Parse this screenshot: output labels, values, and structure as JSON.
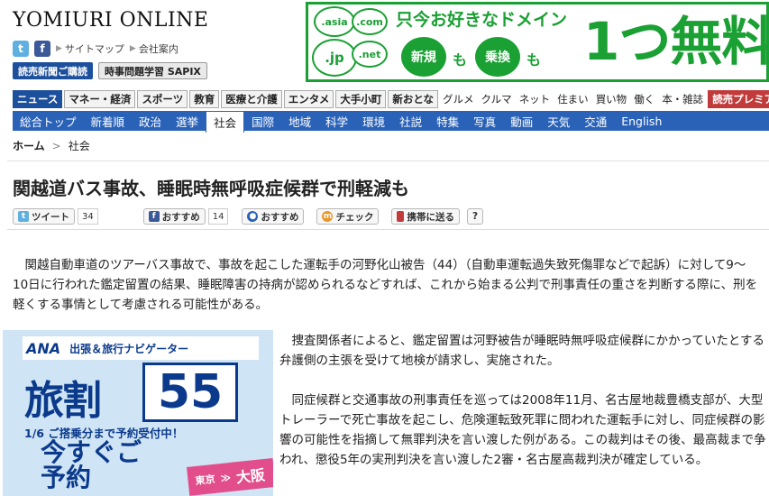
{
  "site": {
    "logo": "YOMIURI ONLINE",
    "links": [
      "サイトマップ",
      "会社案内"
    ],
    "buttons": [
      "読売新聞ご購読",
      "時事問題学習 SAPIX"
    ]
  },
  "banner": {
    "badges": [
      ".asia",
      ".com",
      ".jp",
      ".net"
    ],
    "headline": "只今お好きなドメイン",
    "pill_new": "新規",
    "pill_change": "乗換",
    "mo": "も",
    "big": "1つ無料"
  },
  "categories": [
    {
      "label": "ニュース",
      "style": "active"
    },
    {
      "label": "マネー・経済",
      "style": ""
    },
    {
      "label": "スポーツ",
      "style": ""
    },
    {
      "label": "教育",
      "style": ""
    },
    {
      "label": "医療と介護",
      "style": ""
    },
    {
      "label": "エンタメ",
      "style": ""
    },
    {
      "label": "大手小町",
      "style": ""
    },
    {
      "label": "新おとな",
      "style": ""
    },
    {
      "label": "グルメ",
      "style": "plain"
    },
    {
      "label": "クルマ",
      "style": "plain"
    },
    {
      "label": "ネット",
      "style": "plain"
    },
    {
      "label": "住まい",
      "style": "plain"
    },
    {
      "label": "買い物",
      "style": "plain"
    },
    {
      "label": "働く",
      "style": "plain"
    },
    {
      "label": "本・雑誌",
      "style": "plain"
    },
    {
      "label": "読売プレミアム",
      "style": "premium"
    }
  ],
  "subnav": [
    {
      "label": "総合トップ",
      "active": false
    },
    {
      "label": "新着順",
      "active": false
    },
    {
      "label": "政治",
      "active": false
    },
    {
      "label": "選挙",
      "active": false
    },
    {
      "label": "社会",
      "active": true
    },
    {
      "label": "国際",
      "active": false
    },
    {
      "label": "地域",
      "active": false
    },
    {
      "label": "科学",
      "active": false
    },
    {
      "label": "環境",
      "active": false
    },
    {
      "label": "社説",
      "active": false
    },
    {
      "label": "特集",
      "active": false
    },
    {
      "label": "写真",
      "active": false
    },
    {
      "label": "動画",
      "active": false
    },
    {
      "label": "天気",
      "active": false
    },
    {
      "label": "交通",
      "active": false
    },
    {
      "label": "English",
      "active": false
    }
  ],
  "breadcrumb": {
    "home": "ホーム",
    "sep": ">",
    "current": "社会"
  },
  "article": {
    "title": "関越道バス事故、睡眠時無呼吸症候群で刑軽減も",
    "lead": "　関越自動車道のツアーバス事故で、事故を起こした運転手の河野化山被告（44）（自動車運転過失致死傷罪などで起訴）に対して9～10日に行われた鑑定留置の結果、睡眠障害の持病が認められるなどすれば、これから始まる公判で刑事責任の重さを判断する際に、刑を軽くする事情として考慮される可能性がある。",
    "p2": "　捜査関係者によると、鑑定留置は河野被告が睡眠時無呼吸症候群にかかっていたとする弁護側の主張を受けて地検が請求し、実施された。",
    "p3": "　同症候群と交通事故の刑事責任を巡っては2008年11月、名古屋地裁豊橋支部が、大型トレーラーで死亡事故を起こし、危険運転致死罪に問われた運転手に対し、同症候群の影響の可能性を指摘して無罪判決を言い渡した例がある。この裁判はその後、最高裁まで争われ、懲役5年の実刑判決を言い渡した2審・名古屋高裁判決が確定している。"
  },
  "share": {
    "tweet": "ツイート",
    "tweet_count": "34",
    "fb": "おすすめ",
    "fb_count": "14",
    "recommend": "おすすめ",
    "check": "チェック",
    "mobile": "携帯に送る",
    "help": "?"
  },
  "sidead": {
    "brand": "ANA",
    "subtitle": "出張＆旅行ナビゲーター",
    "tabi": "旅割",
    "num": "55",
    "deadline": "1/6 ご搭乗分まで予約受付中！",
    "cta": "今すぐご予約",
    "route_from": "東京",
    "route_arrow": "≫",
    "route_to": "大阪"
  }
}
